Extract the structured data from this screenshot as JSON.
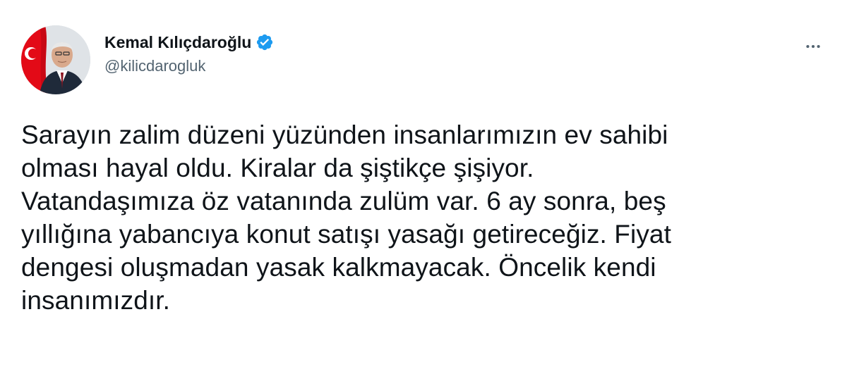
{
  "author": {
    "display_name": "Kemal Kılıçdaroğlu",
    "handle": "@kilicdarogluk",
    "verified": true,
    "avatar_icon": "profile-photo",
    "verified_icon": "verified-badge-icon"
  },
  "menu": {
    "icon": "more-options-icon"
  },
  "tweet": {
    "text": "Sarayın zalim düzeni yüzünden insanlarımızın ev sahibi\nolması hayal oldu. Kiralar da şiştikçe şişiyor.\nVatandaşımıza öz vatanında zulüm var. 6 ay sonra, beş\nyıllığına yabancıya konut satışı yasağı getireceğiz. Fiyat\ndengesi oluşmadan yasak kalkmayacak. Öncelik kendi\ninsanımızdır."
  },
  "colors": {
    "text_primary": "#0f1419",
    "text_secondary": "#536471",
    "verified_blue": "#1d9bf0",
    "flag_red": "#e30a17"
  }
}
